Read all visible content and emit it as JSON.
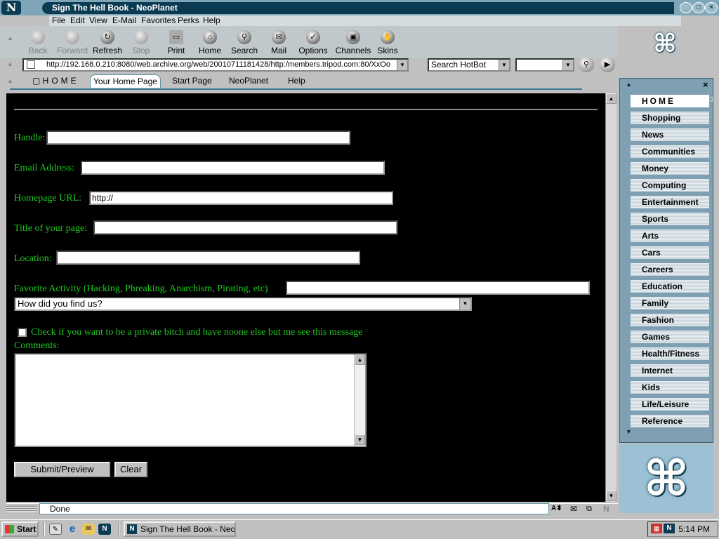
{
  "window": {
    "title": "Sign The Hell Book - NeoPlanet",
    "logo": "N",
    "controls": [
      "minimize-icon",
      "maximize-icon",
      "close-icon"
    ]
  },
  "menu": [
    "File",
    "Edit",
    "View",
    "E-Mail",
    "Favorites",
    "Perks",
    "Help"
  ],
  "toolbar": [
    {
      "label": "Back",
      "icon": "back-icon",
      "enabled": false
    },
    {
      "label": "Forward",
      "icon": "forward-icon",
      "enabled": false
    },
    {
      "label": "Refresh",
      "icon": "refresh-icon",
      "enabled": true
    },
    {
      "label": "Stop",
      "icon": "stop-icon",
      "enabled": false
    },
    {
      "label": "Print",
      "icon": "print-icon",
      "enabled": true
    },
    {
      "label": "Home",
      "icon": "home-icon",
      "enabled": true
    },
    {
      "label": "Search",
      "icon": "search-icon",
      "enabled": true
    },
    {
      "label": "Mail",
      "icon": "mail-icon",
      "enabled": true
    },
    {
      "label": "Options",
      "icon": "options-icon",
      "enabled": true
    },
    {
      "label": "Channels",
      "icon": "channels-icon",
      "enabled": true
    },
    {
      "label": "Skins",
      "icon": "skins-icon",
      "enabled": true
    }
  ],
  "address": {
    "url": "http://192.168.0.210:8080/web.archive.org/web/20010711181428/http:/members.tripod.com:80/XxOo"
  },
  "search": {
    "engine": "Search HotBot",
    "query": ""
  },
  "tabs": {
    "home_label": "HOME",
    "items": [
      "Your Home Page",
      "Start Page",
      "NeoPlanet",
      "Help"
    ],
    "active": "Your Home Page"
  },
  "form": {
    "handle_label": "Handle:",
    "handle_value": "",
    "email_label": "Email Address:",
    "email_value": "",
    "homepage_label": "Homepage URL:",
    "homepage_value": "http://",
    "title_label": "Title of your page:",
    "title_value": "",
    "location_label": "Location:",
    "location_value": "",
    "activity_label": "Favorite Activity (Hacking, Phreaking, Anarchism, Pirating, etc)",
    "activity_value": "",
    "how_found_selected": "How did you find us?",
    "private_checked": false,
    "private_label": "Check if you want to be a private bitch and have noone else but me see this message",
    "comments_label": "Comments:",
    "comments_value": "",
    "submit_label": "Submit/Preview",
    "clear_label": "Clear"
  },
  "sidebar": {
    "items": [
      "HOME",
      "Shopping",
      "News",
      "Communities",
      "Money",
      "Computing",
      "Entertainment",
      "Sports",
      "Arts",
      "Cars",
      "Careers",
      "Education",
      "Family",
      "Fashion",
      "Games",
      "Health/Fitness",
      "Internet",
      "Kids",
      "Life/Leisure",
      "Reference"
    ]
  },
  "status": {
    "text": "Done"
  },
  "taskbar": {
    "start_label": "Start",
    "task_label": "Sign The Hell Book - Neo...",
    "clock": "5:14 PM"
  },
  "colors": {
    "form_text": "#1fc81f",
    "content_bg": "#000000",
    "titlebar": "#0a3b52"
  }
}
